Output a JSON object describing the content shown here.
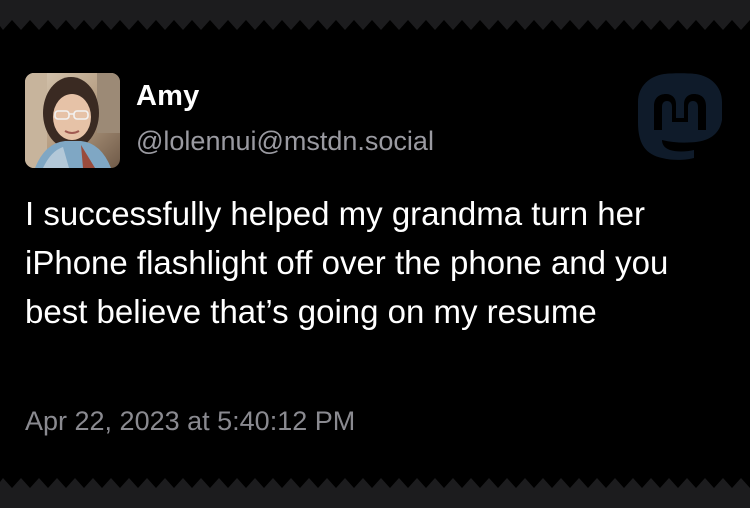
{
  "post": {
    "author": {
      "display_name": "Amy",
      "handle": "@lolennui@mstdn.social"
    },
    "text": "I successfully helped my grandma turn her iPhone flashlight off over the phone and you best believe that’s going on my resume",
    "timestamp": "Apr 22, 2023 at 5:40:12 PM"
  },
  "icons": {
    "avatar": "user-photo",
    "brand": "mastodon-logo-icon"
  },
  "colors": {
    "background": "#000000",
    "edge": "#1c1c1e",
    "text_primary": "#ffffff",
    "text_secondary": "#9a9aa1",
    "logo": "#0f1b2a"
  }
}
